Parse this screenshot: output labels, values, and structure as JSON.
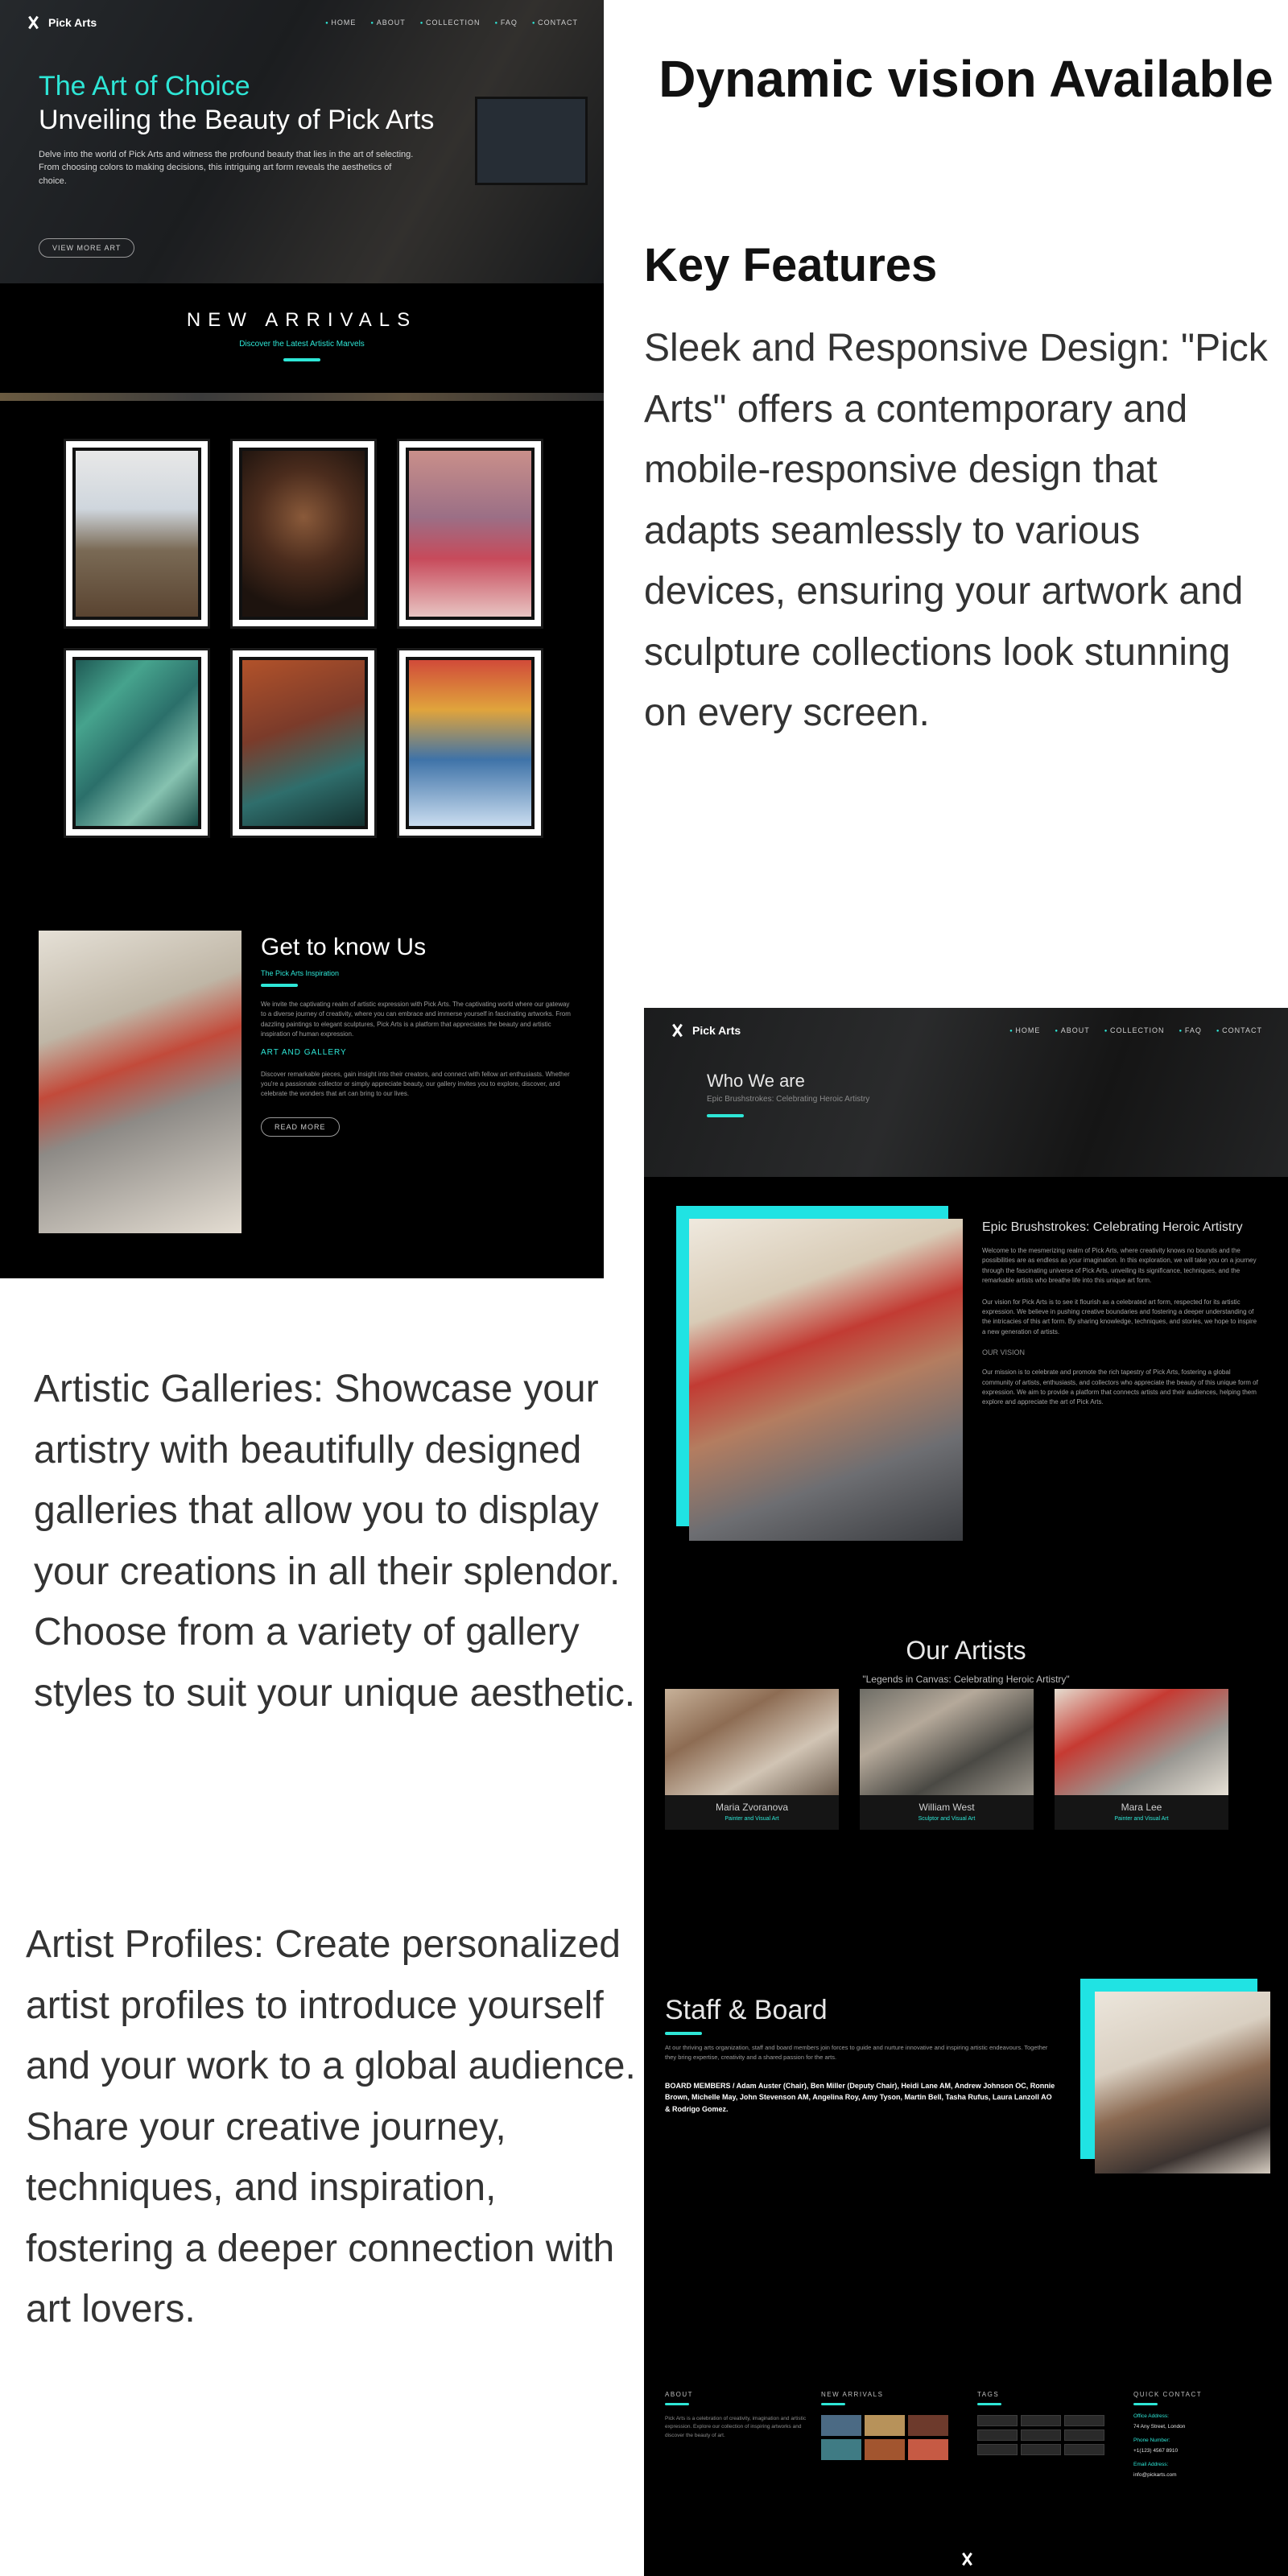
{
  "brand": {
    "name": "Pick Arts"
  },
  "nav": [
    "HOME",
    "ABOUT",
    "COLLECTION",
    "FAQ",
    "CONTACT"
  ],
  "left_screenshot": {
    "hero": {
      "eyebrow": "The Art of Choice",
      "title": "Unveiling the Beauty of Pick Arts",
      "description": "Delve into the world of Pick Arts and witness the profound beauty that lies in the art of selecting. From choosing colors to making decisions, this intriguing art form reveals the aesthetics of choice.",
      "button": "VIEW MORE ART"
    },
    "arrivals": {
      "title": "NEW ARRIVALS",
      "subtitle": "Discover the Latest Artistic Marvels"
    },
    "about": {
      "title": "Get to know Us",
      "subtitle": "The Pick Arts Inspiration",
      "paragraph": "We invite the captivating realm of artistic expression with Pick Arts. The captivating world where our gateway to a diverse journey of creativity, where you can embrace and immerse yourself in fascinating artworks. From dazzling paintings to elegant sculptures, Pick Arts is a platform that appreciates the beauty and artistic inspiration of human expression.",
      "heading2": "ART AND GALLERY",
      "paragraph2": "Discover remarkable pieces, gain insight into their creators, and connect with fellow art enthusiasts. Whether you're a passionate collector or simply appreciate beauty, our gallery invites you to explore, discover, and celebrate the wonders that art can bring to our lives.",
      "button": "READ MORE"
    }
  },
  "promo": {
    "title": "Dynamic vision Available",
    "key_features": "Key Features",
    "features": [
      "Sleek and Responsive Design: \"Pick Arts\" offers a contemporary and mobile-responsive design that adapts seamlessly to various devices, ensuring your artwork and sculpture collections look stunning on every screen.",
      "Artistic Galleries: Showcase your artistry with beautifully designed galleries that allow you to display your creations in all their splendor. Choose from a variety of gallery styles to suit your unique aesthetic.",
      "Artist Profiles: Create personalized artist profiles to introduce yourself and your work to a global audience. Share your creative journey, techniques, and inspiration, fostering a deeper connection with art lovers."
    ]
  },
  "right_screenshot": {
    "header": {
      "title": "Who We are",
      "subtitle": "Epic Brushstrokes: Celebrating Heroic Artistry"
    },
    "who": {
      "title": "Epic Brushstrokes: Celebrating Heroic Artistry",
      "p1": "Welcome to the mesmerizing realm of Pick Arts, where creativity knows no bounds and the possibilities are as endless as your imagination. In this exploration, we will take you on a journey through the fascinating universe of Pick Arts, unveiling its significance, techniques, and the remarkable artists who breathe life into this unique art form.",
      "p2": "Our vision for Pick Arts is to see it flourish as a celebrated art form, respected for its artistic expression. We believe in pushing creative boundaries and fostering a deeper understanding of the intricacies of this art form. By sharing knowledge, techniques, and stories, we hope to inspire a new generation of artists.",
      "sub": "OUR VISION",
      "p3": "Our mission is to celebrate and promote the rich tapestry of Pick Arts, fostering a global community of artists, enthusiasts, and collectors who appreciate the beauty of this unique form of expression. We aim to provide a platform that connects artists and their audiences, helping them explore and appreciate the art of Pick Arts."
    },
    "artists": {
      "title": "Our Artists",
      "quote": "\"Legends in Canvas: Celebrating Heroic Artistry\"",
      "cards": [
        {
          "name": "Maria Zvoranova",
          "role": "Painter and Visual Art"
        },
        {
          "name": "William West",
          "role": "Sculptor and Visual Art"
        },
        {
          "name": "Mara Lee",
          "role": "Painter and Visual Art"
        }
      ]
    },
    "staff": {
      "title": "Staff & Board",
      "paragraph": "At our thriving arts organization, staff and board members join forces to guide and nurture innovative and inspiring artistic endeavours. Together they bring expertise, creativity and a shared passion for the arts.",
      "members": "BOARD MEMBERS / Adam Auster (Chair), Ben Miller (Deputy Chair), Heidi Lane AM, Andrew Johnson OC, Ronnie Brown, Michelle May, John Stevenson AM, Angelina Roy, Amy Tyson, Martin Bell, Tasha Rufus, Laura Lanzoll AO & Rodrigo Gomez."
    },
    "footer": {
      "about": {
        "title": "ABOUT",
        "text": "Pick Arts is a celebration of creativity, imagination and artistic expression. Explore our collection of inspiring artworks and discover the beauty of art."
      },
      "arrivals": {
        "title": "NEW ARRIVALS"
      },
      "tags": {
        "title": "TAGS"
      },
      "contact": {
        "title": "QUICK CONTACT",
        "office_label": "Office Address:",
        "office_value": "74 Any Street, London",
        "phone_label": "Phone Number:",
        "phone_value": "+1(123) 4567 8910",
        "email_label": "Email Address:",
        "email_value": "info@pickarts.com"
      }
    }
  },
  "colors": {
    "accent": "#2ee6d6",
    "panel": "#000000"
  }
}
